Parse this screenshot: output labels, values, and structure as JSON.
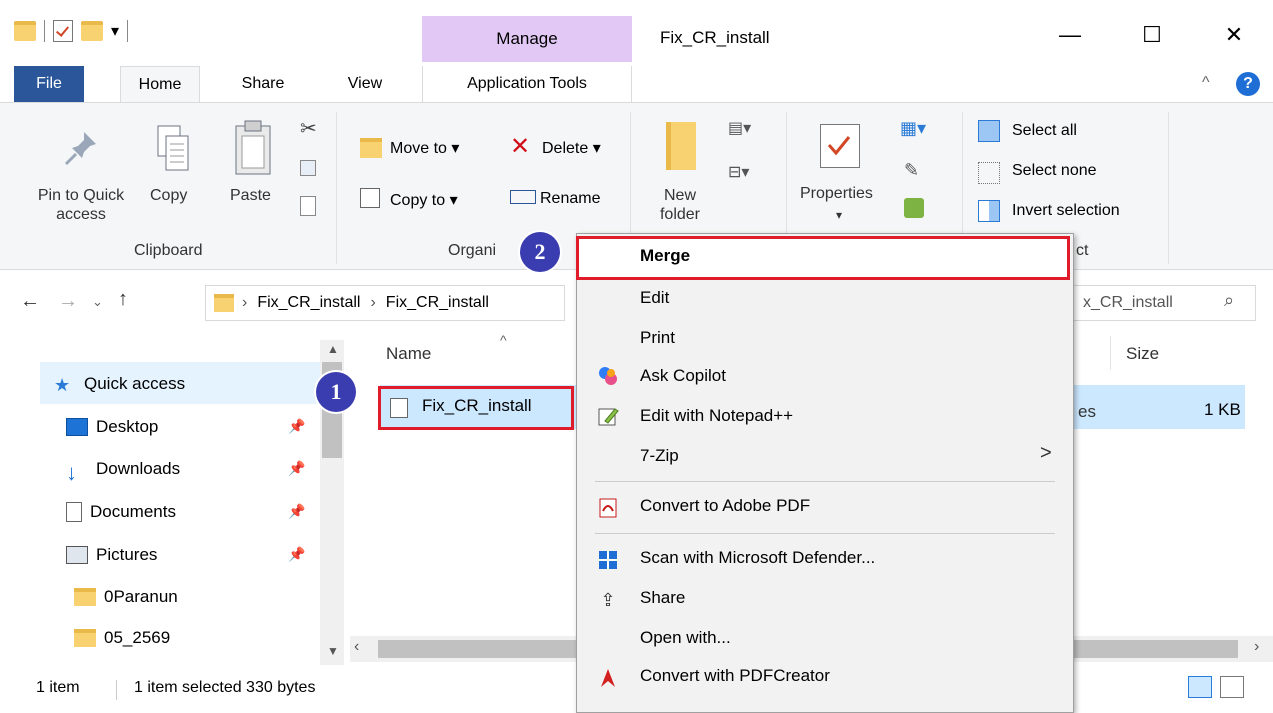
{
  "window": {
    "title": "Fix_CR_install",
    "manage_tab": "Manage",
    "minimize": "—",
    "maximize": "☐",
    "close": "✕",
    "help": "?",
    "collapse": "^"
  },
  "tabs": {
    "file": "File",
    "home": "Home",
    "share": "Share",
    "view": "View",
    "app_tools": "Application Tools"
  },
  "ribbon": {
    "pin_line1": "Pin to Quick",
    "pin_line2": "access",
    "copy": "Copy",
    "paste": "Paste",
    "clipboard": "Clipboard",
    "move_to": "Move to ▾",
    "copy_to": "Copy to ▾",
    "delete": "Delete ▾",
    "rename": "Rename",
    "organize": "Organi",
    "new_folder_l1": "New",
    "new_folder_l2": "folder",
    "properties": "Properties",
    "properties_arrow": "▾",
    "select_all": "Select all",
    "select_none": "Select none",
    "invert_selection": "Invert selection",
    "select_group": "ct"
  },
  "address": {
    "segment1": "Fix_CR_install",
    "segment2": "Fix_CR_install",
    "search_fragment": "x_CR_install"
  },
  "nav": {
    "items": [
      {
        "label": "Quick access"
      },
      {
        "label": "Desktop"
      },
      {
        "label": "Downloads"
      },
      {
        "label": "Documents"
      },
      {
        "label": "Pictures"
      },
      {
        "label": "0Paranun"
      },
      {
        "label": "05_2569"
      }
    ]
  },
  "files": {
    "col_name": "Name",
    "col_size": "Size",
    "row_name": "Fix_CR_install",
    "row_type_frag": "es",
    "row_size": "1 KB"
  },
  "context_menu": {
    "items": [
      "Merge",
      "Edit",
      "Print",
      "Ask Copilot",
      "Edit with Notepad++",
      "7-Zip",
      "Convert to Adobe PDF",
      "Scan with Microsoft Defender...",
      "Share",
      "Open with...",
      "Convert with PDFCreator"
    ],
    "submenu_arrow": ">"
  },
  "badges": {
    "one": "1",
    "two": "2"
  },
  "status": {
    "items": "1 item",
    "selected": "1 item selected  330 bytes"
  },
  "colors": {
    "file_tab": "#2b579a",
    "manage_tab": "#e2c9f5",
    "highlight": "#e01c2a",
    "badge": "#3a3db0",
    "selection": "#cce8ff"
  }
}
